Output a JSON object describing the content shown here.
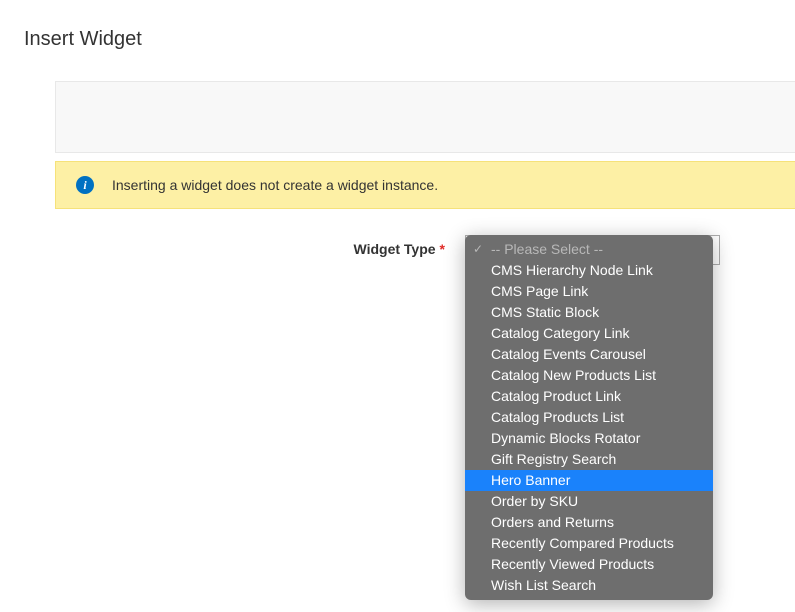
{
  "page_title": "Insert Widget",
  "info_message": "Inserting a widget does not create a widget instance.",
  "field": {
    "label": "Widget Type",
    "required": true
  },
  "dropdown": {
    "placeholder": "-- Please Select --",
    "highlighted_index": 10,
    "options": [
      "CMS Hierarchy Node Link",
      "CMS Page Link",
      "CMS Static Block",
      "Catalog Category Link",
      "Catalog Events Carousel",
      "Catalog New Products List",
      "Catalog Product Link",
      "Catalog Products List",
      "Dynamic Blocks Rotator",
      "Gift Registry Search",
      "Hero Banner",
      "Order by SKU",
      "Orders and Returns",
      "Recently Compared Products",
      "Recently Viewed Products",
      "Wish List Search"
    ]
  }
}
